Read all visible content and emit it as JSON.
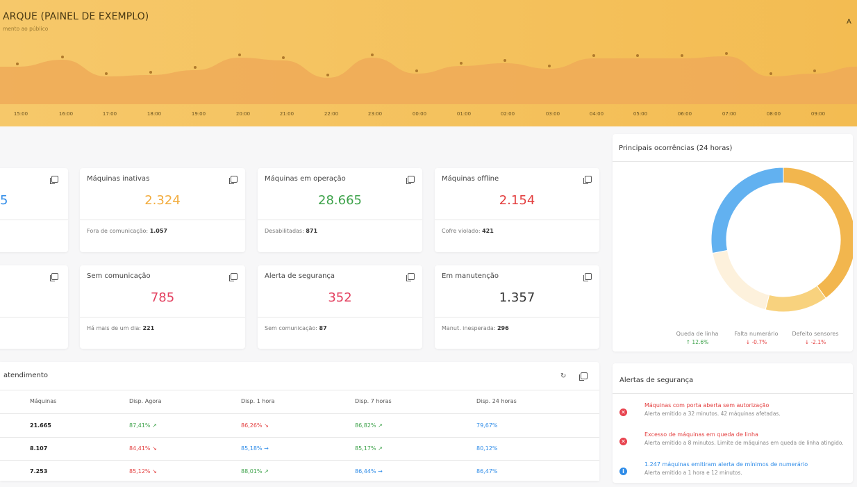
{
  "header": {
    "title": "ARQUE (PAINEL DE EXEMPLO)",
    "subtitle": "mento ao público",
    "right_text": "A",
    "times": [
      "15:00",
      "16:00",
      "17:00",
      "18:00",
      "19:00",
      "20:00",
      "21:00",
      "22:00",
      "23:00",
      "00:00",
      "01:00",
      "02:00",
      "03:00",
      "04:00",
      "05:00",
      "06:00",
      "07:00",
      "08:00",
      "09:00"
    ],
    "colors": {
      "bg": "#f6c45e",
      "wave": "#f0ad55"
    }
  },
  "stats": [
    {
      "title": "",
      "value": "5",
      "color": "blue",
      "foot_label": "",
      "foot_value": ""
    },
    {
      "title": "Máquinas inativas",
      "value": "2.324",
      "color": "orange",
      "foot_label": "Fora de comunicação:",
      "foot_value": "1.057"
    },
    {
      "title": "Máquinas em operação",
      "value": "28.665",
      "color": "green",
      "foot_label": "Desabilitadas:",
      "foot_value": "871"
    },
    {
      "title": "Máquinas offline",
      "value": "2.154",
      "color": "red",
      "foot_label": "Cofre violado:",
      "foot_value": "421"
    },
    {
      "title": "",
      "value": "",
      "color": "dark",
      "foot_label": "",
      "foot_value": ""
    },
    {
      "title": "Sem comunicação",
      "value": "785",
      "color": "pink",
      "foot_label": "Há mais de um dia:",
      "foot_value": "221"
    },
    {
      "title": "Alerta de segurança",
      "value": "352",
      "color": "pink",
      "foot_label": "Sem comunicação:",
      "foot_value": "87"
    },
    {
      "title": "Em manutenção",
      "value": "1.357",
      "color": "dark",
      "foot_label": "Manut. inesperada:",
      "foot_value": "296"
    }
  ],
  "table": {
    "title": "atendimento",
    "columns": [
      "Máquinas",
      "Disp. Agora",
      "Disp. 1 hora",
      "Disp. 7 horas",
      "Disp. 24 horas"
    ],
    "rows": [
      {
        "maquinas": "21.665",
        "agora": "87,41%",
        "agora_trend": "up",
        "h1": "86,26%",
        "h1_trend": "down",
        "h7": "86,82%",
        "h7_trend": "up",
        "h24": "79,67%"
      },
      {
        "maquinas": "8.107",
        "agora": "84,41%",
        "agora_trend": "down",
        "h1": "85,18%",
        "h1_trend": "flat",
        "h7": "85,17%",
        "h7_trend": "up",
        "h24": "80,12%"
      },
      {
        "maquinas": "7.253",
        "agora": "85,12%",
        "agora_trend": "down",
        "h1": "88,01%",
        "h1_trend": "up",
        "h7": "86,44%",
        "h7_trend": "flat",
        "h24": "86,47%"
      }
    ]
  },
  "occurrences": {
    "title": "Principais ocorrências (24 horas)",
    "legend": [
      {
        "name": "Queda de linha",
        "change": "12.6%",
        "direction": "up"
      },
      {
        "name": "Falta numerário",
        "change": "-0.7%",
        "direction": "down"
      },
      {
        "name": "Defeito sensores",
        "change": "-2.1%",
        "direction": "down"
      }
    ]
  },
  "chart_data": {
    "type": "pie",
    "title": "Principais ocorrências (24 horas)",
    "slices": [
      {
        "value": 40,
        "color": "#f2b64e"
      },
      {
        "value": 14,
        "color": "#f8d27e"
      },
      {
        "value": 18,
        "color": "#fdf1dc"
      },
      {
        "value": 28,
        "color": "#62b1f0"
      }
    ]
  },
  "alerts": {
    "title": "Alertas de segurança",
    "items": [
      {
        "type": "error",
        "title": "Máquinas com porta aberta sem autorização",
        "desc": "Alerta emitido a 32 minutos. 42 máquinas afetadas."
      },
      {
        "type": "error",
        "title": "Excesso de máquinas em queda de linha",
        "desc": "Alerta emitido a 8 minutos. Limite de máquinas em queda de linha atingido."
      },
      {
        "type": "info",
        "title": "1.247 máquinas emitiram alerta de mínimos de numerário",
        "desc": "Alerta emitido a 1 hora e 12 minutos."
      }
    ]
  }
}
